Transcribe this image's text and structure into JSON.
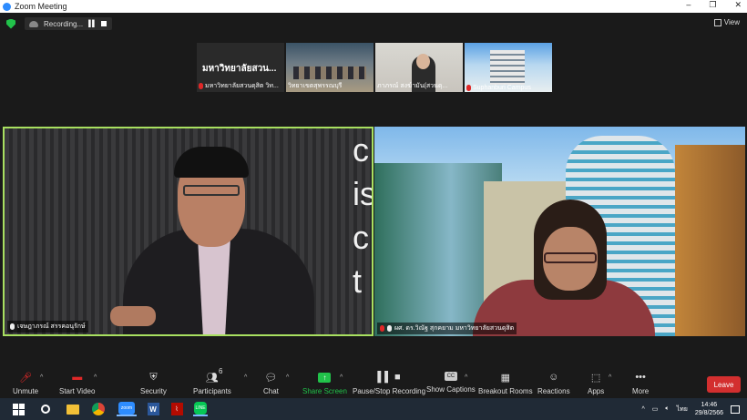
{
  "window": {
    "title": "Zoom Meeting",
    "controls": [
      "–",
      "❐",
      "✕"
    ]
  },
  "topbar": {
    "recording_label": "Recording...",
    "view_label": "View"
  },
  "thumbnails": [
    {
      "name": "มหาวิทยาลัยสวนดุสิต วิท...",
      "big_label": "มหาวิทยาลัยสวน..."
    },
    {
      "name": "วิทยาเขตสุพรรณบุรี"
    },
    {
      "name": "ภาภรณ์ สงฆ์ามัน(สวนดุ..."
    },
    {
      "name": "Suphanburi Campus"
    }
  ],
  "main_tiles": [
    {
      "name": "เจษฎาภรณ์ สรรคอนุรักษ์",
      "glass_text": "c\nis\nc\nt"
    },
    {
      "name": "ผศ. ดร.วิณัฐ สุกคยาม มหาวิทยาลัยสวนดุสิต"
    }
  ],
  "toolbar": {
    "unmute": "Unmute",
    "start_video": "Start Video",
    "security": "Security",
    "participants": "Participants",
    "participants_count": "6",
    "chat": "Chat",
    "share_screen": "Share Screen",
    "pause_stop_recording": "Pause/Stop Recording",
    "show_captions": "Show Captions",
    "breakout_rooms": "Breakout Rooms",
    "reactions": "Reactions",
    "apps": "Apps",
    "more": "More",
    "leave": "Leave",
    "cc": "CC"
  },
  "taskbar": {
    "language": "ไทย",
    "time": "14:46",
    "date": "29/8/2566"
  },
  "colors": {
    "accent_green": "#21c24a",
    "leave_red": "#d32f2f",
    "active_speaker_border": "#a8e060"
  }
}
